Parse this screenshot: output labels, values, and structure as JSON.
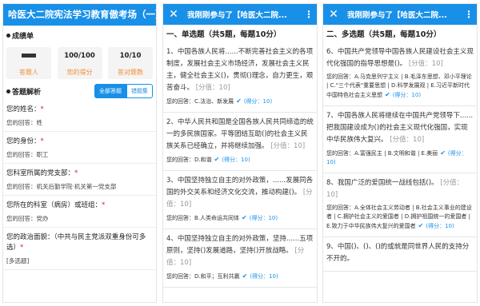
{
  "panel1": {
    "title": "哈医大二院宪法学习教育傲考场（一）",
    "results_heading": "成绩单",
    "stats": [
      {
        "value": "",
        "label": "答题人"
      },
      {
        "value": "100/100",
        "label": "您的得分"
      },
      {
        "value": "10/10",
        "label": "答对题数"
      }
    ],
    "analysis_heading": "答题解析",
    "tab_all": "全部答题",
    "tab_wrong": "错题集",
    "questions": [
      {
        "q": "您的姓名：",
        "req": "*",
        "a": "您的回答：姓"
      },
      {
        "q": "您的身份：",
        "req": "*",
        "a": "您的回答：职工"
      },
      {
        "q": "您科室所属的党支部：",
        "req": "*",
        "a": "您的回答：机关后勤学院·机关第一党支部"
      },
      {
        "q": "您所在的科室（病房）或班组：",
        "req": "*",
        "a": "您的回答：党办"
      },
      {
        "q": "您的政治面貌：（中共与民主党派双重身份可多选）",
        "req": "*",
        "a": "[多选题]"
      }
    ]
  },
  "panel2": {
    "title": "我刚刚参与了【哈医大二院...",
    "section": "一、单选题（共5题，每题10分）",
    "questions": [
      {
        "text": "1、中国各族人民将......不断完善社会主义的各项制度，发展社会主义市场经济，发展社会主义民主，健全社会主义()，贯彻()理念，自力更生，艰苦奋斗。",
        "meta": "[分值：10]",
        "answer": "您的回答：C.法治、新发展",
        "score": "(得分：10)"
      },
      {
        "text": "2、中华人民共和国是全国各族人民共同缔造的统一的多民族国家。平等团结互助()的社会主义民族关系已经确立，并将继续加强。",
        "meta": "[分值：10]",
        "answer": "您的回答：D.和谐",
        "score": "(得分：10)"
      },
      {
        "text": "3、中国坚持独立自主的对外政策，......发展同各国的外交关系和经济文化交流，推动构建()。",
        "meta": "[分值：10]",
        "answer": "您的回答：B.人类命运共同体",
        "score": "(得分：10)"
      },
      {
        "text": "4、中国坚持独立自主的对外政策，坚持......五项原则，坚持()发展道路，坚持()开放战略。",
        "meta": "[分值：10]",
        "answer": "您的回答：D.和平；互利共赢",
        "score": "(得分：10)"
      }
    ]
  },
  "panel3": {
    "title": "我刚刚参与了【哈医大二院...",
    "section": "二、多选题（共5题，每题10分）",
    "questions": [
      {
        "text": "6、中国共产党领导中国各族人民建设社会主义现代化强国的指导思想是()。",
        "meta": "[分值：10]",
        "answer": "您的回答：A.马克思列宁主义 | B.毛泽东思想、邓小平理论 | C.\"三个代表\"重要思想 | D.科学发展观 | E.习近平新时代中国特色社会主义思想",
        "score": "(得分：10)"
      },
      {
        "text": "7、中国各族人民将继续在中国共产党领导下......把我国建设成为()的社会主义现代化强国，实现中华民族伟大复兴。",
        "meta": "[分值：10]",
        "answer": "您的回答：A.富强民主 | B.文明和谐 | E.美丽",
        "score": "(得分：10)"
      },
      {
        "text": "8、我国广泛的爱国统一战线包括()。",
        "meta": "[分值：10]",
        "answer": "您的回答：A.全体社会主义劳动者 | B.社会主义事业的建设者 | C.拥护社会主义的爱国者 | D.拥护祖国统一的爱国者 | E.致力于中华民族伟大复兴的爱国者",
        "score": "(得分：10)"
      },
      {
        "text": "9、中国()、()、()的或就是同世界人民的支持分不开的。",
        "meta": "",
        "answer": "",
        "score": ""
      }
    ]
  }
}
